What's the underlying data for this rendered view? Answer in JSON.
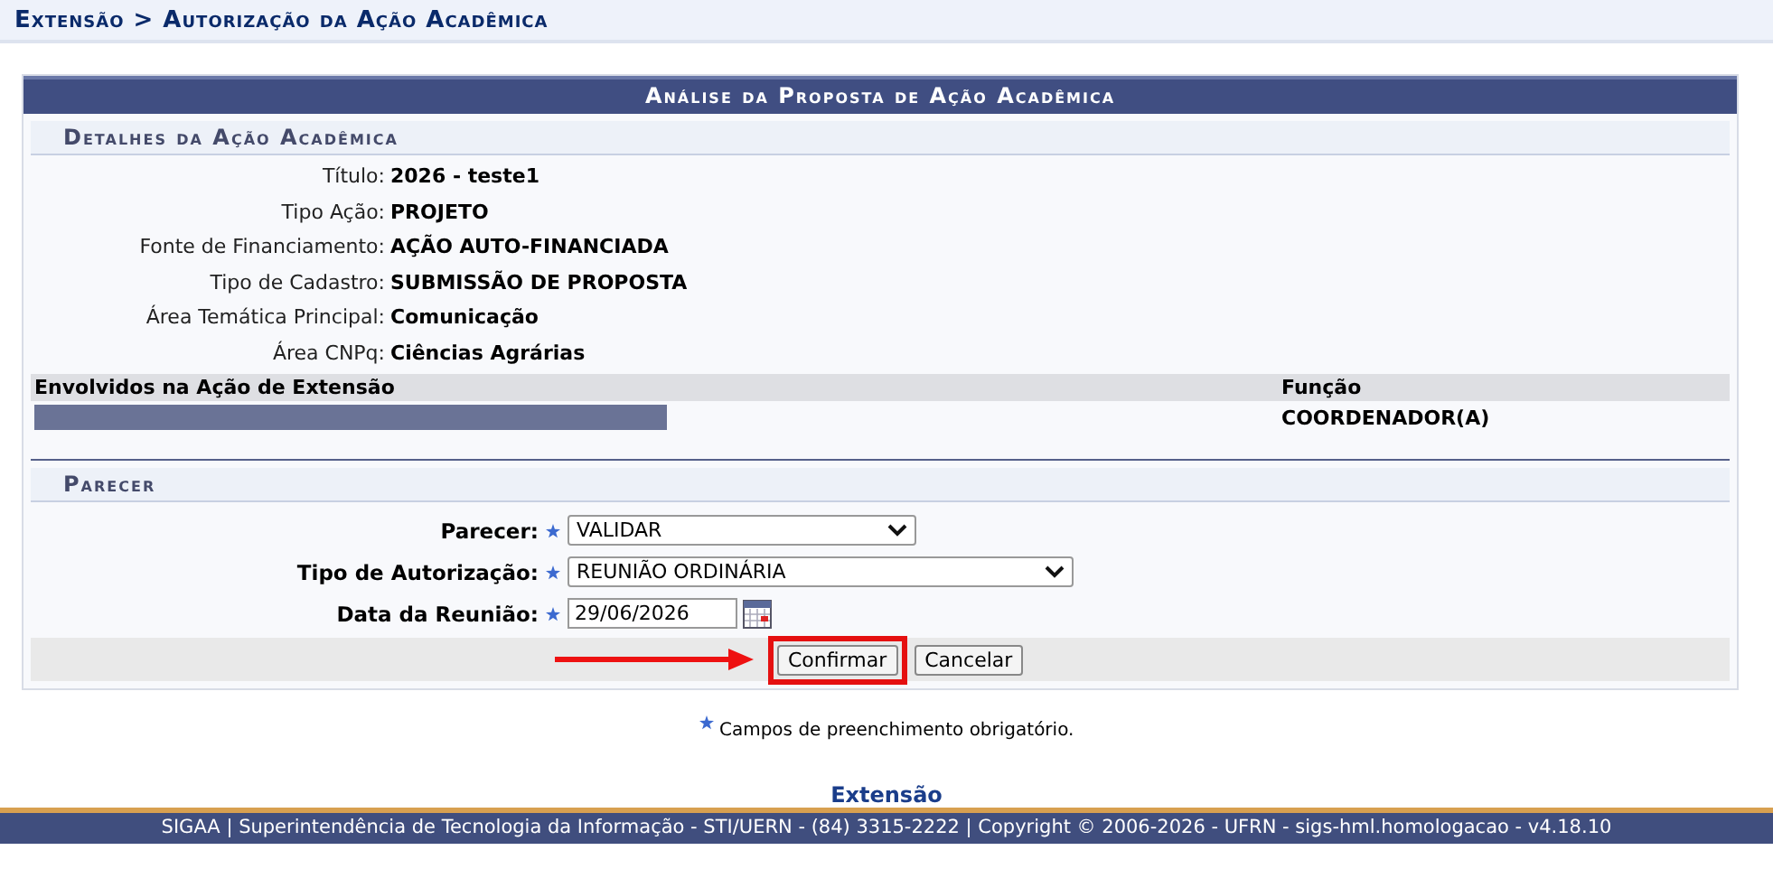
{
  "breadcrumb": "Extensão > Autorização da Ação Acadêmica",
  "panel": {
    "title": "Análise da Proposta de Ação Acadêmica",
    "details": {
      "heading": "Detalhes da Ação Acadêmica",
      "fields": [
        {
          "label": "Título:",
          "value": "2026 - teste1"
        },
        {
          "label": "Tipo Ação:",
          "value": "PROJETO"
        },
        {
          "label": "Fonte de Financiamento:",
          "value": "AÇÃO AUTO-FINANCIADA"
        },
        {
          "label": "Tipo de Cadastro:",
          "value": "SUBMISSÃO DE PROPOSTA"
        },
        {
          "label": "Área Temática Principal:",
          "value": "Comunicação"
        },
        {
          "label": "Área CNPq:",
          "value": "Ciências Agrárias"
        }
      ],
      "members_table": {
        "columns": [
          "Envolvidos na Ação de Extensão",
          "Função"
        ],
        "rows": [
          {
            "name_redacted": true,
            "role": "COORDENADOR(A)"
          }
        ]
      }
    },
    "opinion": {
      "heading": "Parecer",
      "fields": [
        {
          "kind": "select",
          "label": "Parecer:",
          "required": true,
          "value": "VALIDAR"
        },
        {
          "kind": "select",
          "label": "Tipo de Autorização:",
          "required": true,
          "value": "REUNIÃO ORDINÁRIA"
        },
        {
          "kind": "date",
          "label": "Data da Reunião:",
          "required": true,
          "value": "29/06/2026"
        }
      ],
      "buttons": [
        {
          "label": "Confirmar",
          "highlighted": true
        },
        {
          "label": "Cancelar",
          "highlighted": false
        }
      ]
    }
  },
  "required_note": "Campos de preenchimento obrigatório.",
  "footer": {
    "module_link": "Extensão",
    "text": "SIGAA | Superintendência de Tecnologia da Informação - STI/UERN - (84) 3315-2222 | Copyright © 2006-2026 - UFRN - sigs-hml.homologacao - v4.18.10"
  }
}
